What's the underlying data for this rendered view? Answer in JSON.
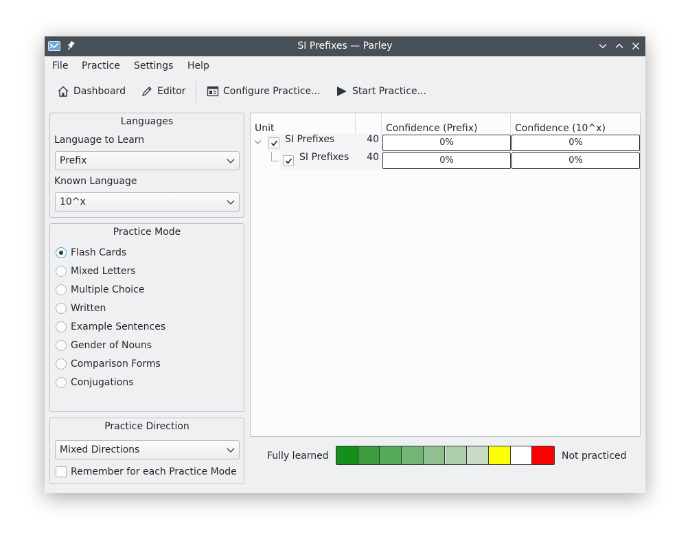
{
  "window": {
    "title": "SI Prefixes — Parley"
  },
  "menu": [
    "File",
    "Practice",
    "Settings",
    "Help"
  ],
  "toolbar": {
    "dashboard": "Dashboard",
    "editor": "Editor",
    "configure": "Configure Practice...",
    "start": "Start Practice..."
  },
  "languages": {
    "title": "Languages",
    "learn_label": "Language to Learn",
    "learn_value": "Prefix",
    "known_label": "Known Language",
    "known_value": "10^x"
  },
  "practice_mode": {
    "title": "Practice Mode",
    "selected": "Flash Cards",
    "options": [
      "Flash Cards",
      "Mixed Letters",
      "Multiple Choice",
      "Written",
      "Example Sentences",
      "Gender of Nouns",
      "Comparison Forms",
      "Conjugations"
    ]
  },
  "practice_direction": {
    "title": "Practice Direction",
    "value": "Mixed Directions",
    "remember_label": "Remember for each Practice Mode",
    "remember_checked": false
  },
  "tree": {
    "headers": {
      "unit": "Unit",
      "count": "",
      "conf_prefix": "Confidence (Prefix)",
      "conf_10x": "Confidence (10^x)"
    },
    "rows": [
      {
        "name": "SI Prefixes",
        "count": "40",
        "conf_prefix": "0%",
        "conf_10x": "0%",
        "checked": true,
        "expanded": true
      },
      {
        "name": "SI Prefixes",
        "count": "40",
        "conf_prefix": "0%",
        "conf_10x": "0%",
        "checked": true
      }
    ]
  },
  "legend": {
    "left_label": "Fully learned",
    "right_label": "Not practiced",
    "colors": [
      "#168f1a",
      "#3a9c3c",
      "#55a958",
      "#73b574",
      "#8fc18e",
      "#acceaa",
      "#c9dcc8",
      "#ffff00",
      "#ffffff",
      "#ff0000"
    ]
  }
}
